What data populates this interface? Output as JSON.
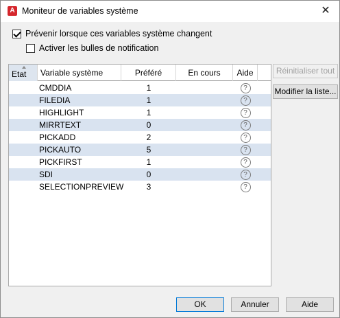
{
  "window": {
    "title": "Moniteur de variables système",
    "app_icon_letter": "A",
    "close_glyph": "✕"
  },
  "options": {
    "notify_label": "Prévenir lorsque ces variables système changent",
    "notify_checked": true,
    "bubbles_label": "Activer les bulles de notification",
    "bubbles_checked": false
  },
  "table": {
    "headers": {
      "etat": "Etat",
      "variable": "Variable système",
      "prefere": "Préféré",
      "en_cours": "En cours",
      "aide": "Aide"
    },
    "rows": [
      {
        "name": "CMDDIA",
        "preferred": "1",
        "current": ""
      },
      {
        "name": "FILEDIA",
        "preferred": "1",
        "current": ""
      },
      {
        "name": "HIGHLIGHT",
        "preferred": "1",
        "current": ""
      },
      {
        "name": "MIRRTEXT",
        "preferred": "0",
        "current": ""
      },
      {
        "name": "PICKADD",
        "preferred": "2",
        "current": ""
      },
      {
        "name": "PICKAUTO",
        "preferred": "5",
        "current": ""
      },
      {
        "name": "PICKFIRST",
        "preferred": "1",
        "current": ""
      },
      {
        "name": "SDI",
        "preferred": "0",
        "current": ""
      },
      {
        "name": "SELECTIONPREVIEW",
        "preferred": "3",
        "current": ""
      }
    ],
    "help_glyph": "?"
  },
  "side_buttons": {
    "reset_all": "Réinitialiser tout",
    "edit_list": "Modifier la liste..."
  },
  "footer": {
    "ok": "OK",
    "cancel": "Annuler",
    "help": "Aide"
  },
  "colors": {
    "alt_row": "#d9e3f0",
    "title_icon": "#d5262c",
    "default_button_border": "#0078d7"
  }
}
